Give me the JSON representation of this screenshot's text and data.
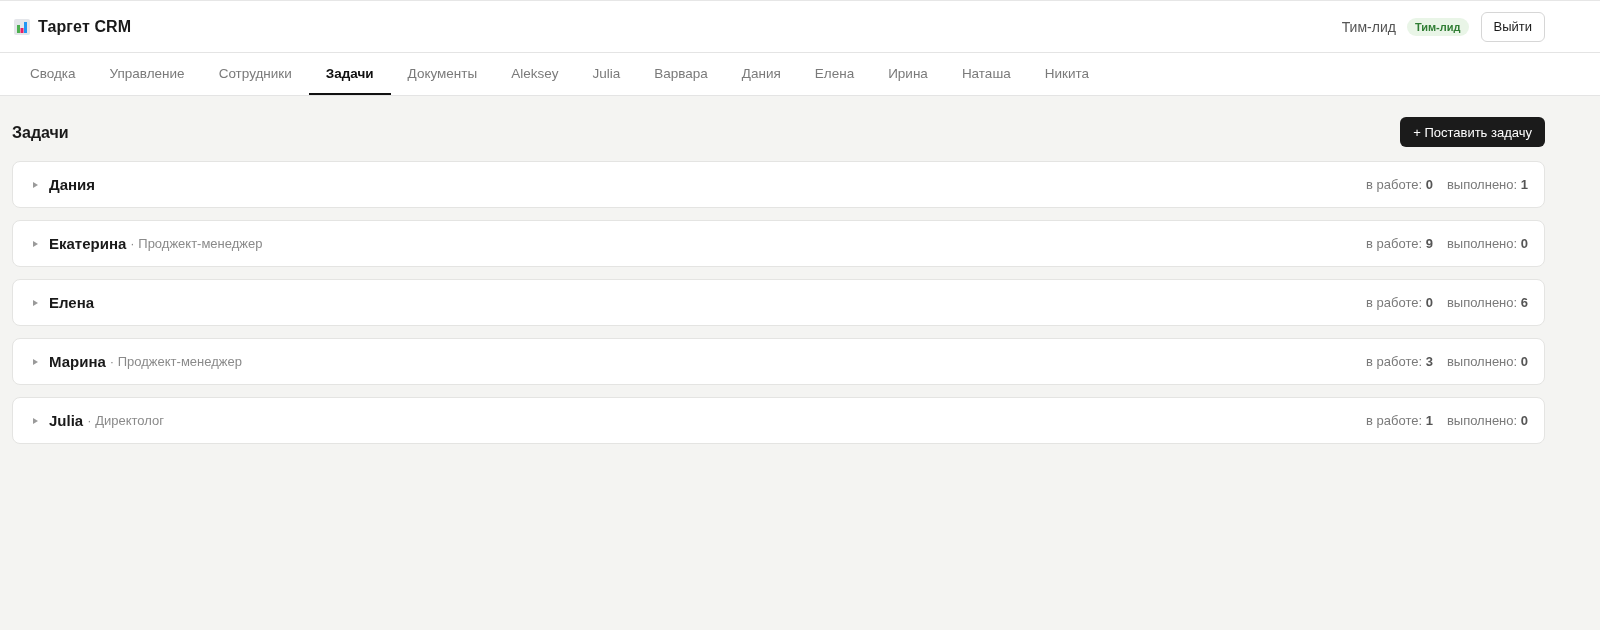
{
  "app": {
    "title": "Таргет CRM"
  },
  "user": {
    "name": "Тим-лид",
    "badge": "Тим-лид",
    "logout": "Выйти"
  },
  "tabs": [
    {
      "label": "Сводка",
      "selected": false
    },
    {
      "label": "Управление",
      "selected": false
    },
    {
      "label": "Сотрудники",
      "selected": false
    },
    {
      "label": "Задачи",
      "selected": true
    },
    {
      "label": "Документы",
      "selected": false
    },
    {
      "label": "Aleksey",
      "selected": false
    },
    {
      "label": "Julia",
      "selected": false
    },
    {
      "label": "Варвара",
      "selected": false
    },
    {
      "label": "Дания",
      "selected": false
    },
    {
      "label": "Елена",
      "selected": false
    },
    {
      "label": "Ирина",
      "selected": false
    },
    {
      "label": "Наташа",
      "selected": false
    },
    {
      "label": "Никита",
      "selected": false
    }
  ],
  "page": {
    "title": "Задачи",
    "add_button": "+ Поставить задачу"
  },
  "groups": [
    {
      "name": "Дания",
      "expanded": false,
      "in_progress": "в работе: **0**",
      "done": "выполнено: **1**"
    },
    {
      "name": "Екатерина",
      "role": "· Проджект-менеджер",
      "expanded": false,
      "in_progress": "в работе: **9**",
      "done": "выполнено: **0**"
    },
    {
      "name": "Елена",
      "expanded": false,
      "in_progress": "в работе: **0**",
      "done": "выполнено: **6**"
    },
    {
      "name": "Марина",
      "role": "· Проджект-менеджер",
      "expanded": false,
      "in_progress": "в работе: **3**",
      "done": "выполнено: **0**"
    },
    {
      "name": "Julia",
      "role": "· Директолог",
      "expanded": false,
      "in_progress": "в работе: **1**",
      "done": "выполнено: **0**"
    }
  ]
}
